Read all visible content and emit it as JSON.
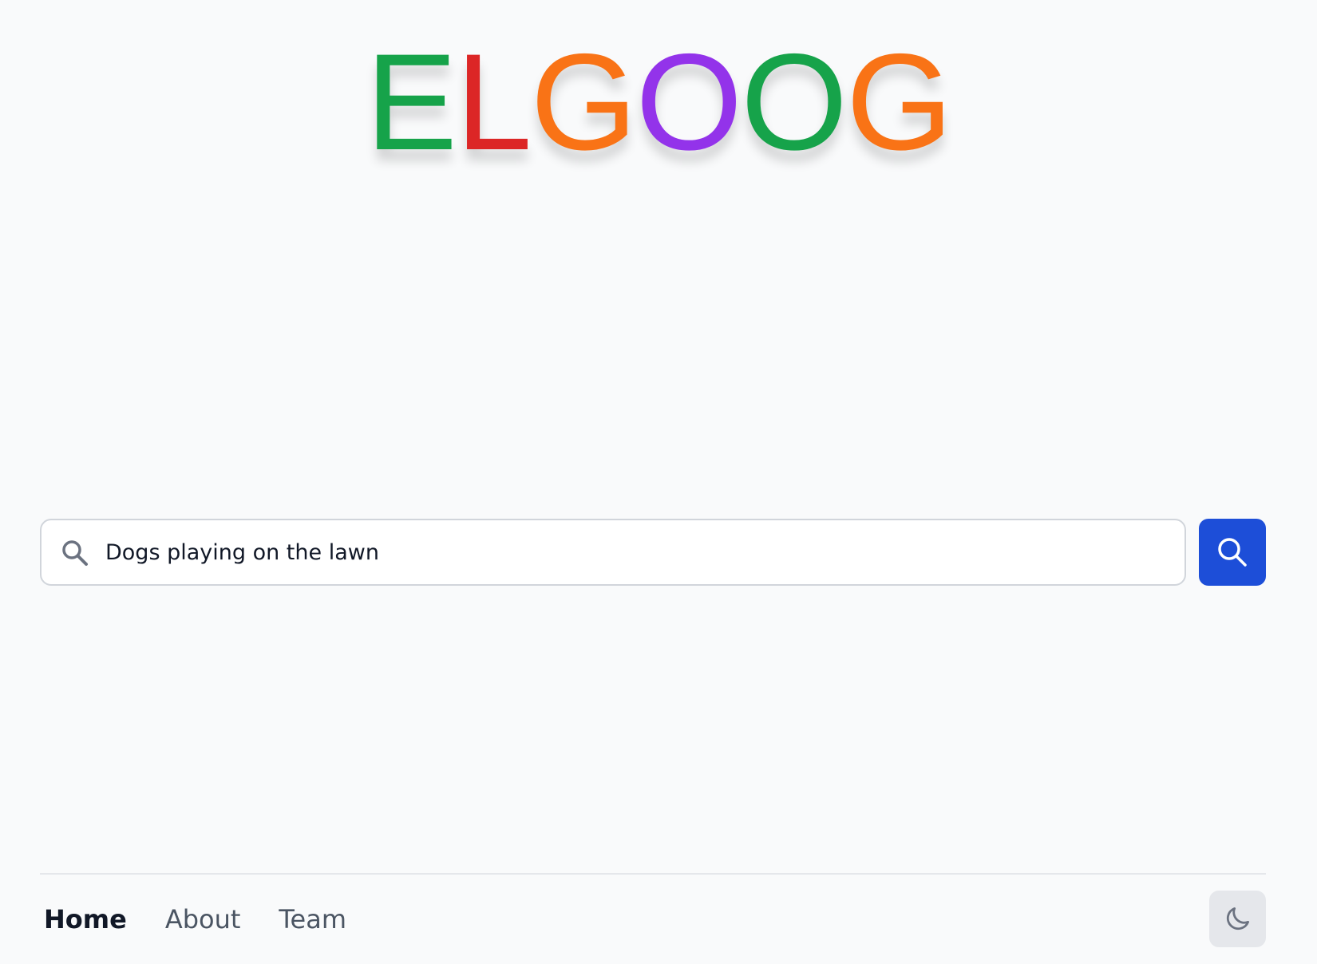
{
  "logo": {
    "letters": [
      {
        "char": "E",
        "color": "#16a34a"
      },
      {
        "char": "L",
        "color": "#dc2626"
      },
      {
        "char": "G",
        "color": "#f97316"
      },
      {
        "char": "O",
        "color": "#9333ea"
      },
      {
        "char": "O",
        "color": "#16a34a"
      },
      {
        "char": "G",
        "color": "#f97316"
      }
    ]
  },
  "search": {
    "value": "Dogs playing on the lawn",
    "leading_icon": "search-icon",
    "button_icon": "search-icon",
    "button_color": "#1d4ed8"
  },
  "footer": {
    "nav": [
      {
        "label": "Home",
        "active": true
      },
      {
        "label": "About",
        "active": false
      },
      {
        "label": "Team",
        "active": false
      }
    ],
    "theme_toggle_icon": "moon-icon"
  }
}
